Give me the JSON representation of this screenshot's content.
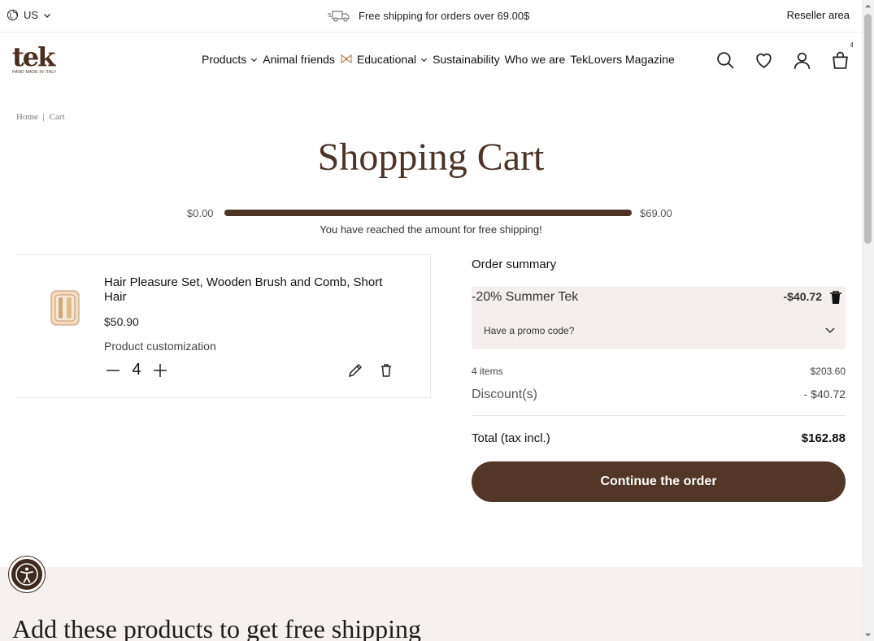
{
  "topbar": {
    "locale": "US",
    "shipping_message": "Free shipping for orders over 69.00$",
    "reseller_label": "Reseller area"
  },
  "header": {
    "logo_text": "tek",
    "logo_tagline": "HAND MADE IN ITALY",
    "nav": [
      {
        "label": "Products",
        "has_dropdown": true
      },
      {
        "label": "Animal friends",
        "has_dropdown": false
      },
      {
        "label": "Educational",
        "has_dropdown": true,
        "icon": "ribbon-icon"
      },
      {
        "label": "Sustainability",
        "has_dropdown": false
      },
      {
        "label": "Who we are",
        "has_dropdown": false
      },
      {
        "label": "TekLovers Magazine",
        "has_dropdown": false
      }
    ],
    "cart_count": "4",
    "icons": [
      "search-icon",
      "heart-icon",
      "user-icon",
      "cart-icon"
    ]
  },
  "breadcrumb": {
    "home": "Home",
    "separator": "|",
    "current": "Cart"
  },
  "page_title": "Shopping Cart",
  "progress": {
    "min_label": "$0.00",
    "max_label": "$69.00",
    "fraction": 1.0,
    "note": "You have reached the amount for free shipping!"
  },
  "cart_item": {
    "name": "Hair Pleasure Set, Wooden Brush and Comb, Short Hair",
    "price": "$50.90",
    "customization_label": "Product customization",
    "quantity": "4"
  },
  "summary": {
    "title": "Order summary",
    "promo_applied_name": "-20% Summer Tek",
    "promo_applied_amount": "-$40.72",
    "promo_question": "Have a promo code?",
    "items_label": "4 items",
    "items_value": "$203.60",
    "discount_label": "Discount(s)",
    "discount_value": "- $40.72",
    "total_label": "Total (tax incl.)",
    "total_value": "$162.88",
    "cta_label": "Continue the order"
  },
  "recommendations": {
    "title": "Add these products to get free shipping"
  },
  "colors": {
    "brand": "#523628",
    "promo_bg": "#f4eeee",
    "section_bg": "#f6f0f0"
  }
}
